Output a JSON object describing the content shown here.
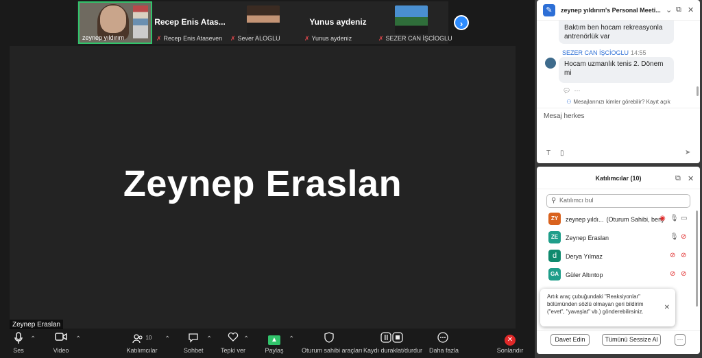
{
  "thumbnails": {
    "self": {
      "label": "zeynep yıldırım"
    },
    "recep": {
      "name": "Recep  Enis  Atas...",
      "label": "Recep Enis Ataseven"
    },
    "sever": {
      "label": "Sever ALOGLU"
    },
    "yunus": {
      "name": "Yunus aydeniz",
      "label": "Yunus aydeniz"
    },
    "sezer": {
      "label": "SEZER CAN İŞCİOGLU"
    }
  },
  "main": {
    "speaker_name": "Zeynep Eraslan",
    "speaker_label": "Zeynep Eraslan"
  },
  "toolbar": {
    "audio": "Ses",
    "video": "Video",
    "participants": "Katılımcılar",
    "participants_count": "10",
    "chat": "Sohbet",
    "reactions": "Tepki ver",
    "share": "Paylaş",
    "host_tools": "Oturum sahibi araçları",
    "record": "Kaydı duraklat/durdur",
    "more": "Daha fazla",
    "end": "Sonlandır"
  },
  "chat": {
    "title": "zeynep yıldırım's Personal Meeti...",
    "message1": "Baktım ben hocam rekreasyonla antrenörlük var",
    "message2_sender": "SEZER CAN İŞCİOGLU",
    "message2_time": "14:55",
    "message2": "Hocam uzmanlık tenis 2. Dönem mi",
    "visibility": "Mesajlarınızı kimler görebilir? Kayıt açık",
    "input_placeholder": "Mesaj herkes"
  },
  "participants": {
    "title": "Katılımcılar (10)",
    "search_placeholder": "Katılımcı bul",
    "rows": [
      {
        "initials": "ZY",
        "name": "zeynep yıldı...",
        "role": "(Oturum Sahibi, ben)",
        "color": "#d9621e"
      },
      {
        "initials": "ZE",
        "name": "Zeynep Eraslan",
        "color": "#1f9e8a"
      },
      {
        "initials": "d",
        "name": "Derya Yılmaz",
        "color": "#0f8a6e"
      },
      {
        "initials": "GA",
        "name": "Güler Altıntop",
        "color": "#1f9e8a"
      }
    ],
    "tooltip": "Artık araç çubuğundaki \"Reaksiyonlar\" bölümünden sözlü olmayan geri bildirim (\"evet\", \"yavaşlat\" vb.) gönderebilirsiniz.",
    "invite": "Davet Edin",
    "mute_all": "Tümünü Sessize Al",
    "more": "···"
  }
}
